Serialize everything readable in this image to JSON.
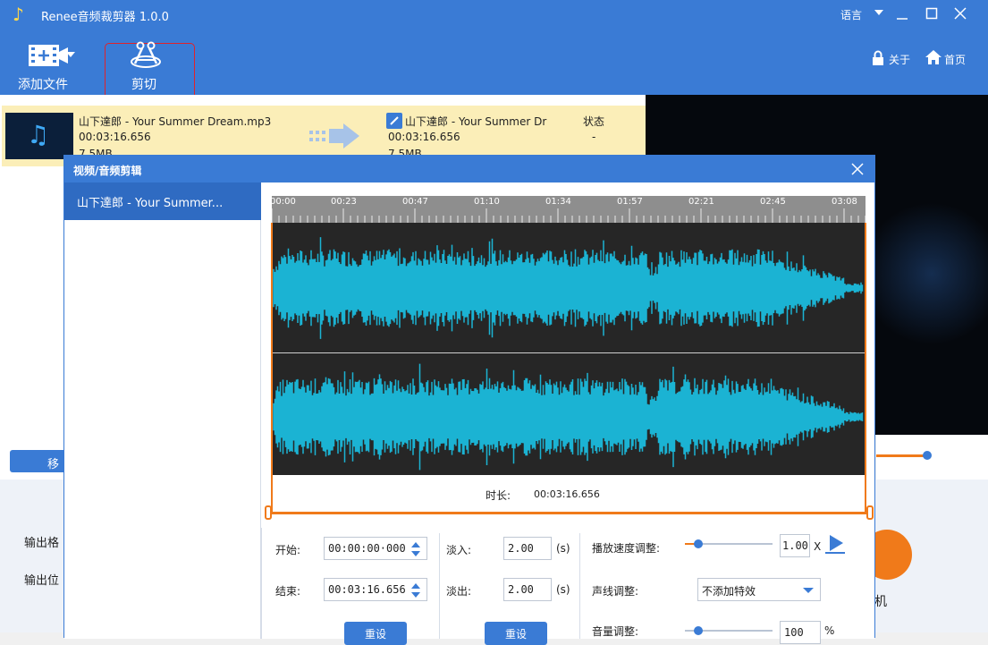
{
  "window": {
    "title": "Renee音频裁剪器 1.0.0",
    "language": "语言"
  },
  "toolbar": {
    "add_file": "添加文件",
    "cut": "剪切",
    "about": "关于",
    "home": "首页"
  },
  "file_row": {
    "src_name": "山下達郎 - Your Summer Dream.mp3",
    "src_duration": "00:03:16.656",
    "src_size": "7.5MB",
    "dst_name": "山下達郎 - Your Summer Dr",
    "dst_duration": "00:03:16.656",
    "dst_size": "7.5MB",
    "status_header": "状态",
    "status_value": "-"
  },
  "bottom": {
    "move_btn": "移",
    "output_format_label": "输出格",
    "output_location_label": "输出位",
    "start_label": "机"
  },
  "dialog": {
    "title": "视频/音频剪辑",
    "sidebar_item": "山下達郎 - Your Summer...",
    "ruler_ticks": [
      "00:00",
      "00:23",
      "00:47",
      "01:10",
      "01:34",
      "01:57",
      "02:21",
      "02:45",
      "03:08"
    ],
    "duration_label": "时长:",
    "duration_value": "00:03:16.656",
    "start_label": "开始:",
    "start_value": "00:00:00·000",
    "end_label": "结束:",
    "end_value": "00:03:16.656",
    "reset1": "重设",
    "fade_in_label": "淡入:",
    "fade_in_value": "2.00",
    "fade_out_label": "淡出:",
    "fade_out_value": "2.00",
    "unit_s": "(s)",
    "reset2": "重设",
    "speed_label": "播放速度调整:",
    "speed_value": "1.00",
    "speed_unit": "X",
    "speed_level": 0.15,
    "voice_label": "声线调整:",
    "voice_value": "不添加特效",
    "volume_label": "音量调整:",
    "volume_value": "100",
    "volume_unit": "%"
  },
  "colors": {
    "accent": "#3a7bd5",
    "wave": "#1bb3d3",
    "orange": "#f07a1a",
    "highlight": "#fbeeb8"
  }
}
